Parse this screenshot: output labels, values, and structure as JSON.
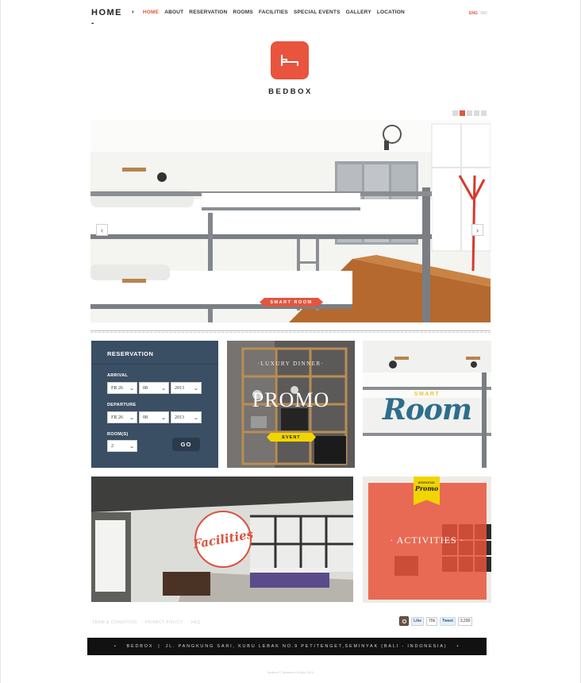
{
  "header": {
    "brand": "HOME",
    "brand_dash": "-",
    "nav": [
      "HOME",
      "ABOUT",
      "RESERVATION",
      "ROOMS",
      "FACILITIES",
      "SPECIAL EVENTS",
      "GALLERY",
      "LOCATION"
    ],
    "active_nav": "HOME",
    "lang_active": "ENG",
    "lang_other": "IND"
  },
  "logo": {
    "name": "BEDBOX",
    "color": "#e8543d"
  },
  "slider": {
    "badge": "SMART ROOM",
    "dots": 5,
    "active_dot": 2
  },
  "reservation": {
    "title": "RESERVATION",
    "arrival_label": "ARRIVAL",
    "arrival": {
      "day": "FR 26",
      "month": "08",
      "year": "2013"
    },
    "departure_label": "DEPARTURE",
    "departure": {
      "day": "FR 26",
      "month": "08",
      "year": "2013"
    },
    "rooms_label": "ROOM(S)",
    "rooms": "2",
    "go": "GO"
  },
  "promo": {
    "subtitle": "·LUXURY DINNER·",
    "title": "PROMO",
    "tag": "EVENT"
  },
  "smart_room": {
    "top": "SMART",
    "word": "Room"
  },
  "facilities": {
    "badge": "Facilities"
  },
  "activities": {
    "label": "· ACTIVITIES ·",
    "ribbon_top": "WEEKEND",
    "ribbon_word": "Promo"
  },
  "footer": {
    "links": [
      "TERM & CONDITION",
      "·",
      "PRIVACY POLICY",
      "·",
      "FAQ"
    ],
    "fb_like": "Like",
    "fb_count": "70k",
    "tweet": "Tweet",
    "tweet_count": "3,290",
    "brand": "BEDBOX",
    "address": "JL. PANGKUNG SARI, KUBU LEBAK NO.9 PETITENGET,SEMINYAK (BALI - INDONESIA)",
    "copyright": "Bedbox © Weekend Studio 2013"
  },
  "colors": {
    "accent": "#e2563f",
    "reservation_bg": "#3a4e64",
    "address_bg": "#111111"
  }
}
